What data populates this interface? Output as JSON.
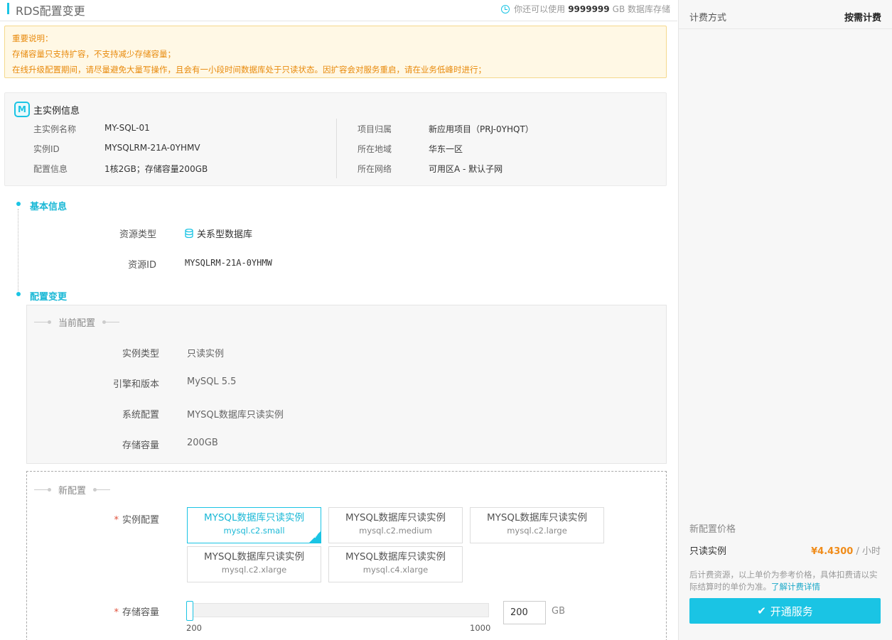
{
  "header": {
    "title": "RDS配置变更",
    "quota_prefix": "你还可以使用",
    "quota_value": "9999999",
    "quota_suffix": "GB 数据库存储"
  },
  "notice": {
    "line1": "重要说明：",
    "line2": "存储容量只支持扩容，不支持减少存储容量；",
    "line3": "在线升级配置期间，请尽量避免大量写操作，且会有一小段时间数据库处于只读状态。因扩容会对服务重启，请在业务低峰时进行；"
  },
  "instance": {
    "title": "主实例信息",
    "icon_text": "M",
    "rows_left": [
      {
        "k": "主实例名称",
        "v": "MY-SQL-01"
      },
      {
        "k": "实例ID",
        "v": "MYSQLRM-21A-0YHMV"
      },
      {
        "k": "配置信息",
        "v": "1核2GB；存储容量200GB"
      }
    ],
    "rows_right": [
      {
        "k": "项目归属",
        "v": "新应用项目（PRJ-0YHQT）"
      },
      {
        "k": "所在地域",
        "v": "华东一区"
      },
      {
        "k": "所在网络",
        "v": "可用区A - 默认子网"
      }
    ]
  },
  "basic": {
    "title": "基本信息",
    "resource_type_label": "资源类型",
    "resource_type_value": "关系型数据库",
    "resource_id_label": "资源ID",
    "resource_id_value": "MYSQLRM-21A-0YHMW"
  },
  "config": {
    "title": "配置变更",
    "current_legend": "当前配置",
    "current": [
      {
        "k": "实例类型",
        "v": "只读实例"
      },
      {
        "k": "引擎和版本",
        "v": "MySQL 5.5"
      },
      {
        "k": "系统配置",
        "v": "MYSQL数据库只读实例"
      },
      {
        "k": "存储容量",
        "v": "200GB"
      }
    ],
    "new_legend": "新配置",
    "instance_label": "实例配置",
    "options": [
      {
        "name": "MYSQL数据库只读实例",
        "code": "mysql.c2.small",
        "selected": true
      },
      {
        "name": "MYSQL数据库只读实例",
        "code": "mysql.c2.medium",
        "selected": false
      },
      {
        "name": "MYSQL数据库只读实例",
        "code": "mysql.c2.large",
        "selected": false
      },
      {
        "name": "MYSQL数据库只读实例",
        "code": "mysql.c2.xlarge",
        "selected": false
      },
      {
        "name": "MYSQL数据库只读实例",
        "code": "mysql.c4.xlarge",
        "selected": false
      }
    ],
    "storage_label": "存储容量",
    "storage_min": "200",
    "storage_max": "1000",
    "storage_value": "200",
    "storage_unit": "GB",
    "storage_fraction": 0
  },
  "side": {
    "billing_label": "计费方式",
    "billing_value": "按需计费",
    "new_price_label": "新配置价格",
    "item_label": "只读实例",
    "price": "¥4.4300",
    "price_unit": "/ 小时",
    "note": "后计费资源，以上单价为参考价格，具体扣费请以实际结算时的单价为准。",
    "note_link": "了解计费详情",
    "submit_label": "开通服务"
  },
  "colors": {
    "accent": "#1ac4e4",
    "warning": "#e88a0c",
    "price": "#f08c1a"
  }
}
